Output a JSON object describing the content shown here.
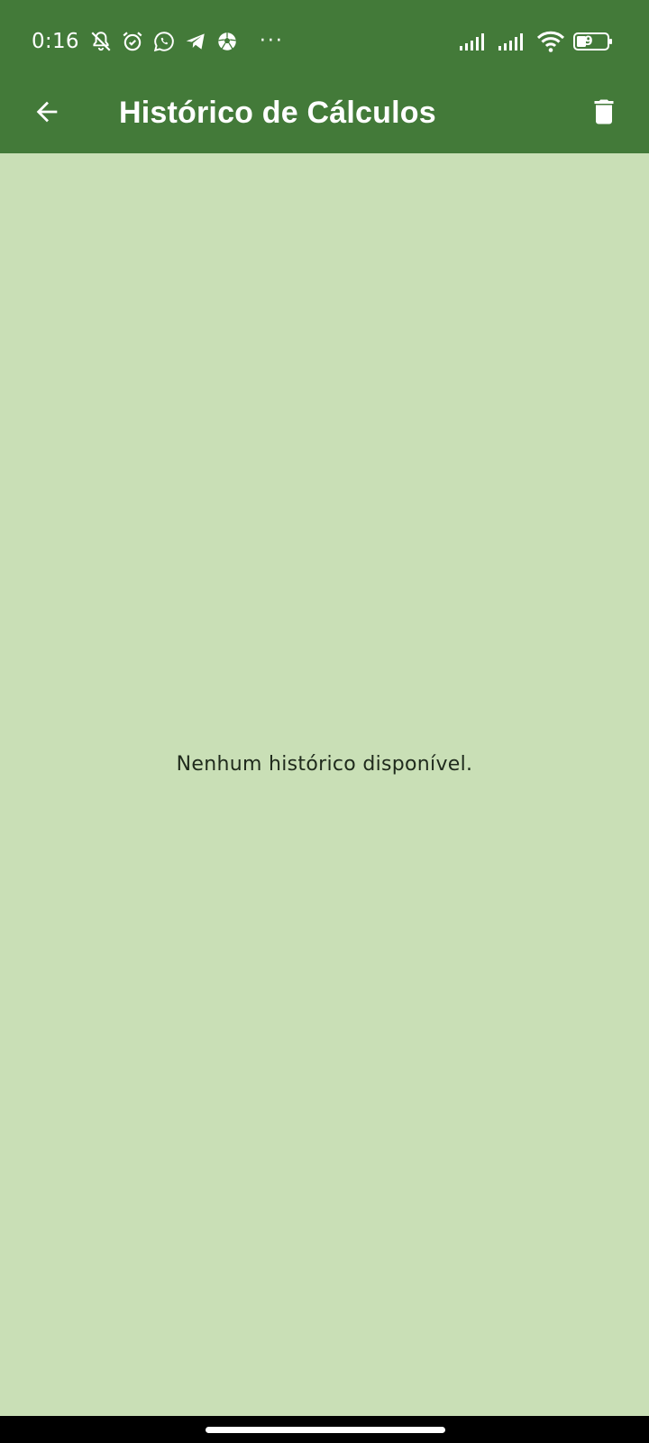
{
  "status_bar": {
    "time": "0:16",
    "left_icons": [
      "mute-notifications-icon",
      "alarm-icon",
      "whatsapp-icon",
      "telegram-icon",
      "soccer-ball-icon"
    ],
    "overflow": "···",
    "right_icons": [
      "signal-icon",
      "signal-icon",
      "wifi-icon",
      "battery-icon"
    ],
    "battery_level": "39",
    "battery_text_visible": "9"
  },
  "app_bar": {
    "title": "Histórico de Cálculos",
    "back_icon": "arrow-back-icon",
    "action_icon": "delete-icon"
  },
  "main": {
    "empty_message": "Nenhum histórico disponível."
  },
  "colors": {
    "app_bar": "#437a39",
    "background": "#c9dfb6",
    "text": "#1f2a1c",
    "nav_bar": "#000000"
  }
}
